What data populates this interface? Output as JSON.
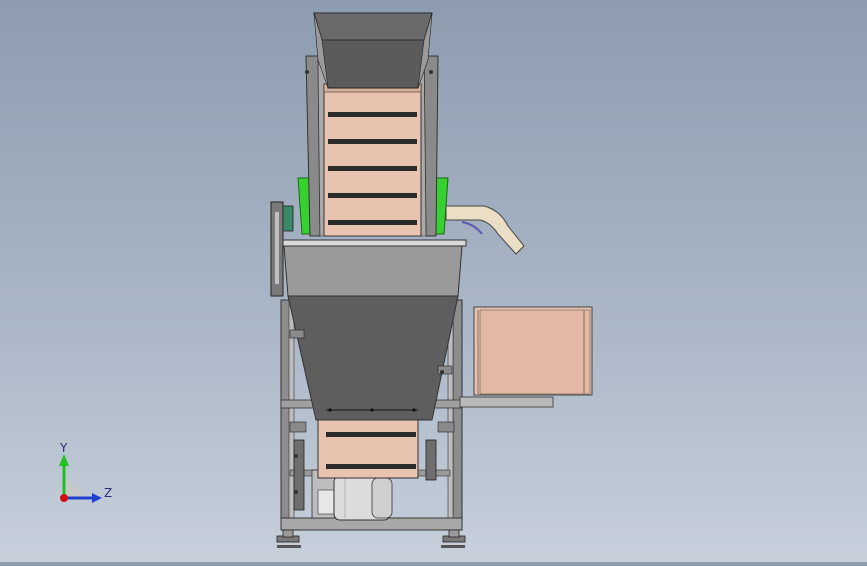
{
  "window": {
    "title": ""
  },
  "model": {
    "name": ""
  },
  "triad": {
    "y_label": "Y",
    "z_label": "Z",
    "y_axis_color": "#20c020",
    "z_axis_color": "#2040d0",
    "origin_color": "#d01010"
  },
  "colors": {
    "background_top": "#8d9cb0",
    "background_bottom": "#c7d0db",
    "belt": "#e8c4b0",
    "belt_slat": "#2a2a2a",
    "hopper_dark": "#5b5b5b",
    "hopper_light": "#9e9e9e",
    "frame": "#8a8a8a",
    "green_part": "#36d030",
    "chute": "#eadfc4",
    "box": "#e9c3b1",
    "motor": "#dcdcdc"
  }
}
